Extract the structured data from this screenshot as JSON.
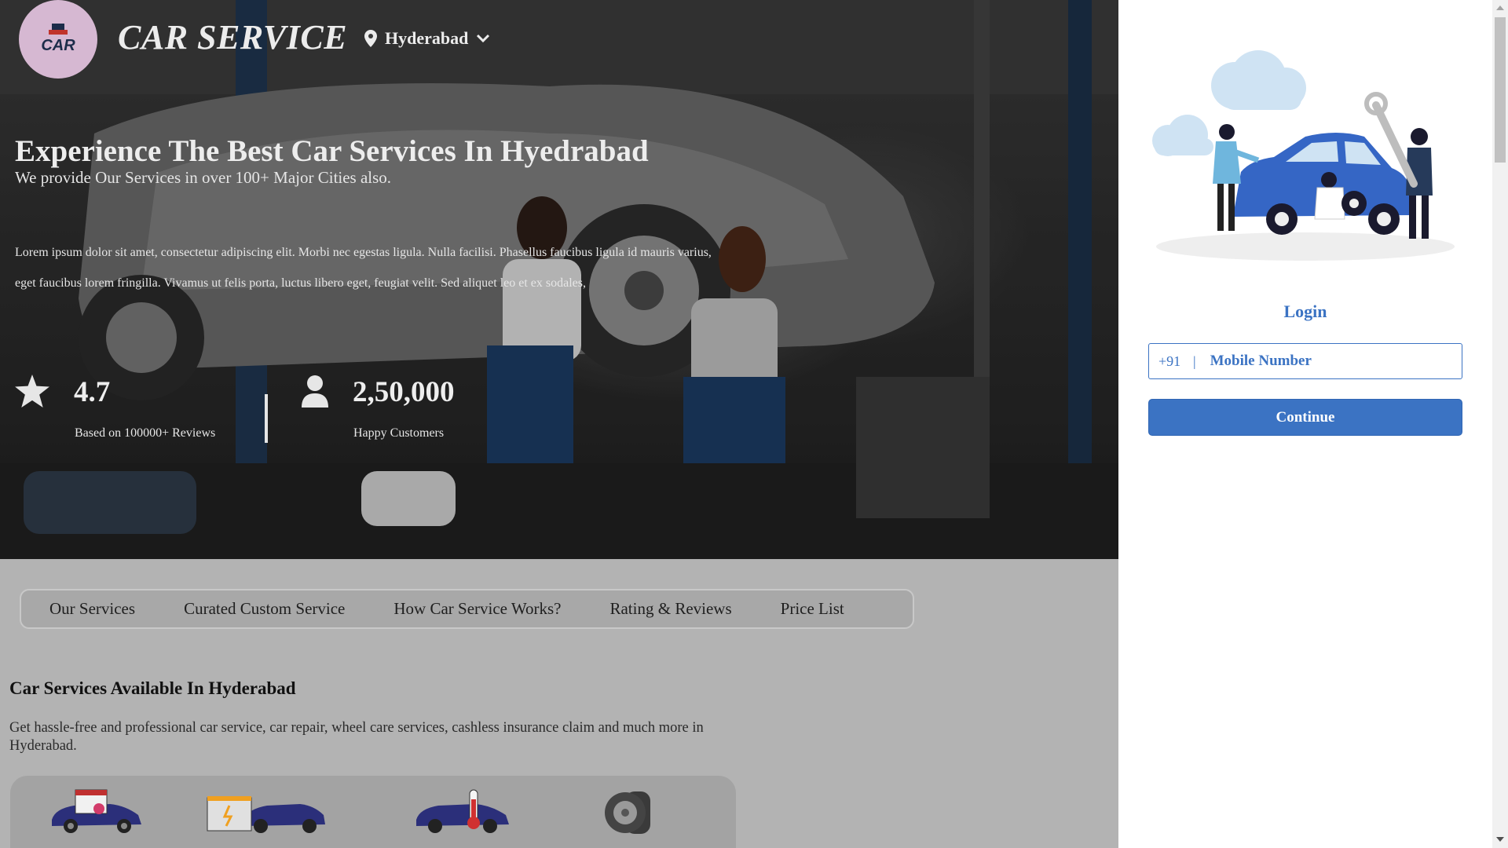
{
  "header": {
    "brand": "CAR SERVICE",
    "logo_text": "CAR",
    "city": "Hyderabad"
  },
  "hero": {
    "title": "Experience The Best Car Services In Hyedrabad",
    "subtitle": "We provide Our Services in over 100+ Major Cities also.",
    "body": "Lorem ipsum dolor sit amet, consectetur adipiscing elit. Morbi nec egestas ligula. Nulla facilisi. Phasellus faucibus ligula id mauris varius, eget faucibus lorem fringilla. Vivamus ut felis porta, luctus libero eget, feugiat velit. Sed aliquet leo et ex sodales,",
    "stats": [
      {
        "icon": "star-icon",
        "value": "4.7",
        "label": "Based on 100000+ Reviews"
      },
      {
        "icon": "person-icon",
        "value": "2,50,000",
        "label": "Happy Customers"
      }
    ]
  },
  "tabs": [
    "Our Services",
    "Curated Custom Service",
    "How Car Service Works?",
    "Rating & Reviews",
    "Price List"
  ],
  "section": {
    "title": "Car Services Available In Hyderabad",
    "description": "Get hassle-free and professional car service, car repair, wheel care services, cashless insurance claim and much more in Hyderabad."
  },
  "services": [
    {
      "icon": "car-calendar-icon"
    },
    {
      "icon": "car-battery-icon"
    },
    {
      "icon": "car-ac-thermometer-icon"
    },
    {
      "icon": "tyre-icon"
    }
  ],
  "login": {
    "title": "Login",
    "country_code": "+91",
    "separator": "|",
    "phone_placeholder": "Mobile Number",
    "continue_label": "Continue"
  },
  "colors": {
    "accent": "#3b73c3",
    "hero_text": "#ececec",
    "logo_bg": "#d6b8d2"
  }
}
